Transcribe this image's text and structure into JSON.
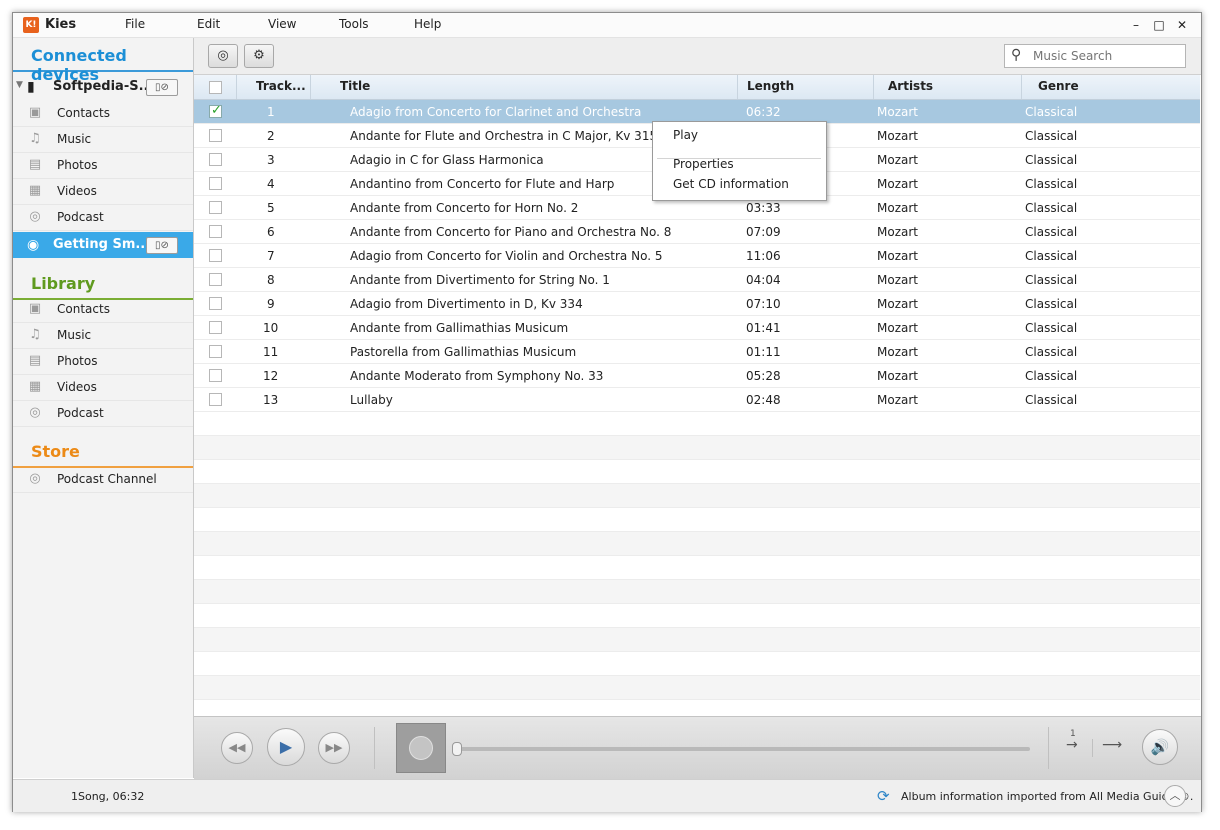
{
  "app": {
    "title": "Kies",
    "logo_text": "K!"
  },
  "menu": [
    "File",
    "Edit",
    "View",
    "Tools",
    "Help"
  ],
  "window_controls": {
    "minimize": "–",
    "maximize": "□",
    "close": "✕"
  },
  "sidebar": {
    "connected_title": "Connected devices",
    "devices": [
      {
        "name": "Softpedia-S...",
        "button": "▯⊘"
      },
      {
        "name": "Getting Sm...",
        "button": "▯⊘"
      }
    ],
    "device_items": [
      "Contacts",
      "Music",
      "Photos",
      "Videos",
      "Podcast"
    ],
    "library_title": "Library",
    "library_items": [
      "Contacts",
      "Music",
      "Photos",
      "Videos",
      "Podcast"
    ],
    "store_title": "Store",
    "store_items": [
      "Podcast Channel"
    ]
  },
  "toolbar": {
    "search_placeholder": "Music Search"
  },
  "table": {
    "headers": [
      "Track...",
      "Title",
      "Length",
      "Artists",
      "Genre"
    ],
    "rows": [
      {
        "track": "1",
        "title": "Adagio from Concerto for Clarinet and Orchestra",
        "length": "06:32",
        "artist": "Mozart",
        "genre": "Classical"
      },
      {
        "track": "2",
        "title": "Andante for Flute and Orchestra in C Major, Kv 315",
        "length": "",
        "artist": "Mozart",
        "genre": "Classical"
      },
      {
        "track": "3",
        "title": "Adagio in C for Glass Harmonica",
        "length": "",
        "artist": "Mozart",
        "genre": "Classical"
      },
      {
        "track": "4",
        "title": "Andantino from Concerto for Flute and Harp",
        "length": "",
        "artist": "Mozart",
        "genre": "Classical"
      },
      {
        "track": "5",
        "title": "Andante from Concerto for Horn No. 2",
        "length": "03:33",
        "artist": "Mozart",
        "genre": "Classical"
      },
      {
        "track": "6",
        "title": "Andante from Concerto for Piano and Orchestra No. 8",
        "length": "07:09",
        "artist": "Mozart",
        "genre": "Classical"
      },
      {
        "track": "7",
        "title": "Adagio from Concerto for Violin and Orchestra No. 5",
        "length": "11:06",
        "artist": "Mozart",
        "genre": "Classical"
      },
      {
        "track": "8",
        "title": "Andante from Divertimento for String No. 1",
        "length": "04:04",
        "artist": "Mozart",
        "genre": "Classical"
      },
      {
        "track": "9",
        "title": "Adagio from Divertimento in D, Kv 334",
        "length": "07:10",
        "artist": "Mozart",
        "genre": "Classical"
      },
      {
        "track": "10",
        "title": "Andante from Gallimathias Musicum",
        "length": "01:41",
        "artist": "Mozart",
        "genre": "Classical"
      },
      {
        "track": "11",
        "title": "Pastorella from Gallimathias Musicum",
        "length": "01:11",
        "artist": "Mozart",
        "genre": "Classical"
      },
      {
        "track": "12",
        "title": "Andante Moderato from Symphony No. 33",
        "length": "05:28",
        "artist": "Mozart",
        "genre": "Classical"
      },
      {
        "track": "13",
        "title": "Lullaby",
        "length": "02:48",
        "artist": "Mozart",
        "genre": "Classical"
      }
    ]
  },
  "context_menu": {
    "items": [
      "Play",
      "Properties",
      "Get CD information"
    ]
  },
  "player": {
    "repeat_label": "1",
    "progress": 0.0
  },
  "status": {
    "left": "1Song, 06:32",
    "right": "Album information imported from All Media Guide ®."
  },
  "colors": {
    "accent_blue": "#1c8fd6",
    "library_green": "#5f9a1e",
    "store_orange": "#ec8a16",
    "selection": "#a7c8e0"
  }
}
